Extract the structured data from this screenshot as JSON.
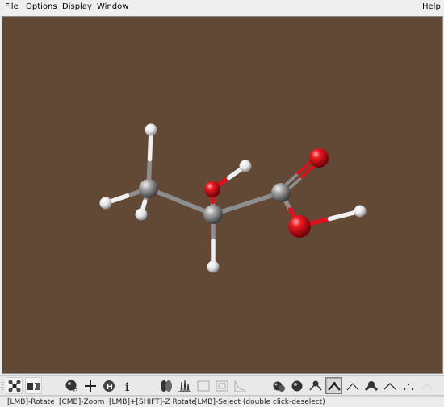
{
  "menu": {
    "file": "File",
    "options": "Options",
    "display": "Display",
    "window": "Window",
    "help": "Help"
  },
  "viewport": {
    "background_color": "#624936",
    "molecule": {
      "atoms": [
        {
          "id": "H1",
          "element": "H"
        },
        {
          "id": "C1",
          "element": "C"
        },
        {
          "id": "H2",
          "element": "H"
        },
        {
          "id": "H3",
          "element": "H"
        },
        {
          "id": "O1",
          "element": "O"
        },
        {
          "id": "H4",
          "element": "H"
        },
        {
          "id": "C2",
          "element": "C"
        },
        {
          "id": "H5",
          "element": "H"
        },
        {
          "id": "C3",
          "element": "C"
        },
        {
          "id": "O2",
          "element": "O"
        },
        {
          "id": "O3",
          "element": "O"
        },
        {
          "id": "H6",
          "element": "H"
        }
      ],
      "bonds": [
        [
          "C1",
          "H1",
          1
        ],
        [
          "C1",
          "H2",
          1
        ],
        [
          "C1",
          "H3",
          1
        ],
        [
          "C1",
          "C2",
          1
        ],
        [
          "C2",
          "O1",
          1
        ],
        [
          "O1",
          "H4",
          1
        ],
        [
          "C2",
          "H5",
          1
        ],
        [
          "C2",
          "C3",
          1
        ],
        [
          "C3",
          "O2",
          2
        ],
        [
          "C3",
          "O3",
          1
        ],
        [
          "O3",
          "H6",
          1
        ]
      ],
      "element_colors": {
        "C": "#8e8e8e",
        "H": "#f0f0f0",
        "O": "#e0101a"
      }
    }
  },
  "toolbar": {
    "buttons": [
      {
        "icon": "molecule-builder-icon",
        "state": "normal"
      },
      {
        "icon": "stereo-view-icon",
        "state": "normal"
      },
      {
        "icon": "sphere-render-icon",
        "state": "normal"
      },
      {
        "icon": "add-atom-icon",
        "state": "normal"
      },
      {
        "icon": "hydrogen-icon",
        "state": "normal"
      },
      {
        "icon": "info-icon",
        "state": "normal"
      },
      {
        "icon": "orbital-icon",
        "state": "normal"
      },
      {
        "icon": "spectrum-icon",
        "state": "normal"
      },
      {
        "icon": "box-icon",
        "state": "disabled"
      },
      {
        "icon": "grid-box-icon",
        "state": "disabled"
      },
      {
        "icon": "plot-icon",
        "state": "disabled"
      },
      {
        "icon": "space-fill-icon",
        "state": "normal"
      },
      {
        "icon": "ball-stick-icon",
        "state": "normal"
      },
      {
        "icon": "ball-wire-icon",
        "state": "normal"
      },
      {
        "icon": "stick-icon",
        "state": "pressed"
      },
      {
        "icon": "wire-icon",
        "state": "normal"
      },
      {
        "icon": "ball-angle-icon",
        "state": "normal"
      },
      {
        "icon": "thin-angle-icon",
        "state": "normal"
      },
      {
        "icon": "dot-icon",
        "state": "normal"
      },
      {
        "icon": "blank-icon",
        "state": "disabled"
      }
    ]
  },
  "status": {
    "rotate": "[LMB]-Rotate",
    "zoom": "[CMB]-Zoom",
    "z_rotate": "[LMB]+[SHIFT]-Z Rotate",
    "select": "[LMB]-Select (double click-deselect)"
  }
}
